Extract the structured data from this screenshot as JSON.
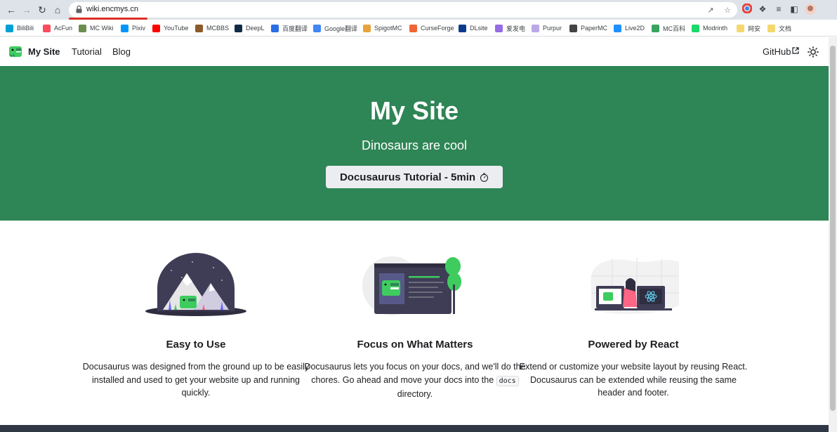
{
  "browser": {
    "url": "wiki.encmys.cn",
    "bookmarks": [
      {
        "label": "BiliBili",
        "color": "#00a1d6"
      },
      {
        "label": "AcFun",
        "color": "#fd4c5d"
      },
      {
        "label": "MC Wiki",
        "color": "#6b8e4e"
      },
      {
        "label": "Pixiv",
        "color": "#0096fa"
      },
      {
        "label": "YouTube",
        "color": "#ff0000"
      },
      {
        "label": "MCBBS",
        "color": "#8b5a2b"
      },
      {
        "label": "DeepL",
        "color": "#0f2b46"
      },
      {
        "label": "百度翻译",
        "color": "#2b6de5"
      },
      {
        "label": "Google翻译",
        "color": "#4285f4"
      },
      {
        "label": "SpigotMC",
        "color": "#e8a33d"
      },
      {
        "label": "CurseForge",
        "color": "#f16436"
      },
      {
        "label": "DLsite",
        "color": "#0b3a8c"
      },
      {
        "label": "爱发电",
        "color": "#946ce6"
      },
      {
        "label": "Purpur",
        "color": "#b9a9e8"
      },
      {
        "label": "PaperMC",
        "color": "#444444"
      },
      {
        "label": "Live2D",
        "color": "#1e90ff"
      },
      {
        "label": "MC百科",
        "color": "#3aa35f"
      },
      {
        "label": "Modrinth",
        "color": "#1bd96a"
      },
      {
        "label": "网安",
        "color": "#f5d76e"
      },
      {
        "label": "文档",
        "color": "#f5d76e"
      }
    ]
  },
  "navbar": {
    "brand": "My Site",
    "links": [
      "Tutorial",
      "Blog"
    ],
    "github": "GitHub"
  },
  "hero": {
    "title": "My Site",
    "subtitle": "Dinosaurs are cool",
    "button": "Docusaurus Tutorial - 5min"
  },
  "features": [
    {
      "title": "Easy to Use",
      "text": "Docusaurus was designed from the ground up to be easily installed and used to get your website up and running quickly."
    },
    {
      "title": "Focus on What Matters",
      "text_before": "Docusaurus lets you focus on your docs, and we'll do the chores. Go ahead and move your docs into the ",
      "code": "docs",
      "text_after": " directory."
    },
    {
      "title": "Powered by React",
      "text": "Extend or customize your website layout by reusing React. Docusaurus can be extended while reusing the same header and footer."
    }
  ],
  "colors": {
    "primary": "#2e8555",
    "footer": "#303846"
  }
}
